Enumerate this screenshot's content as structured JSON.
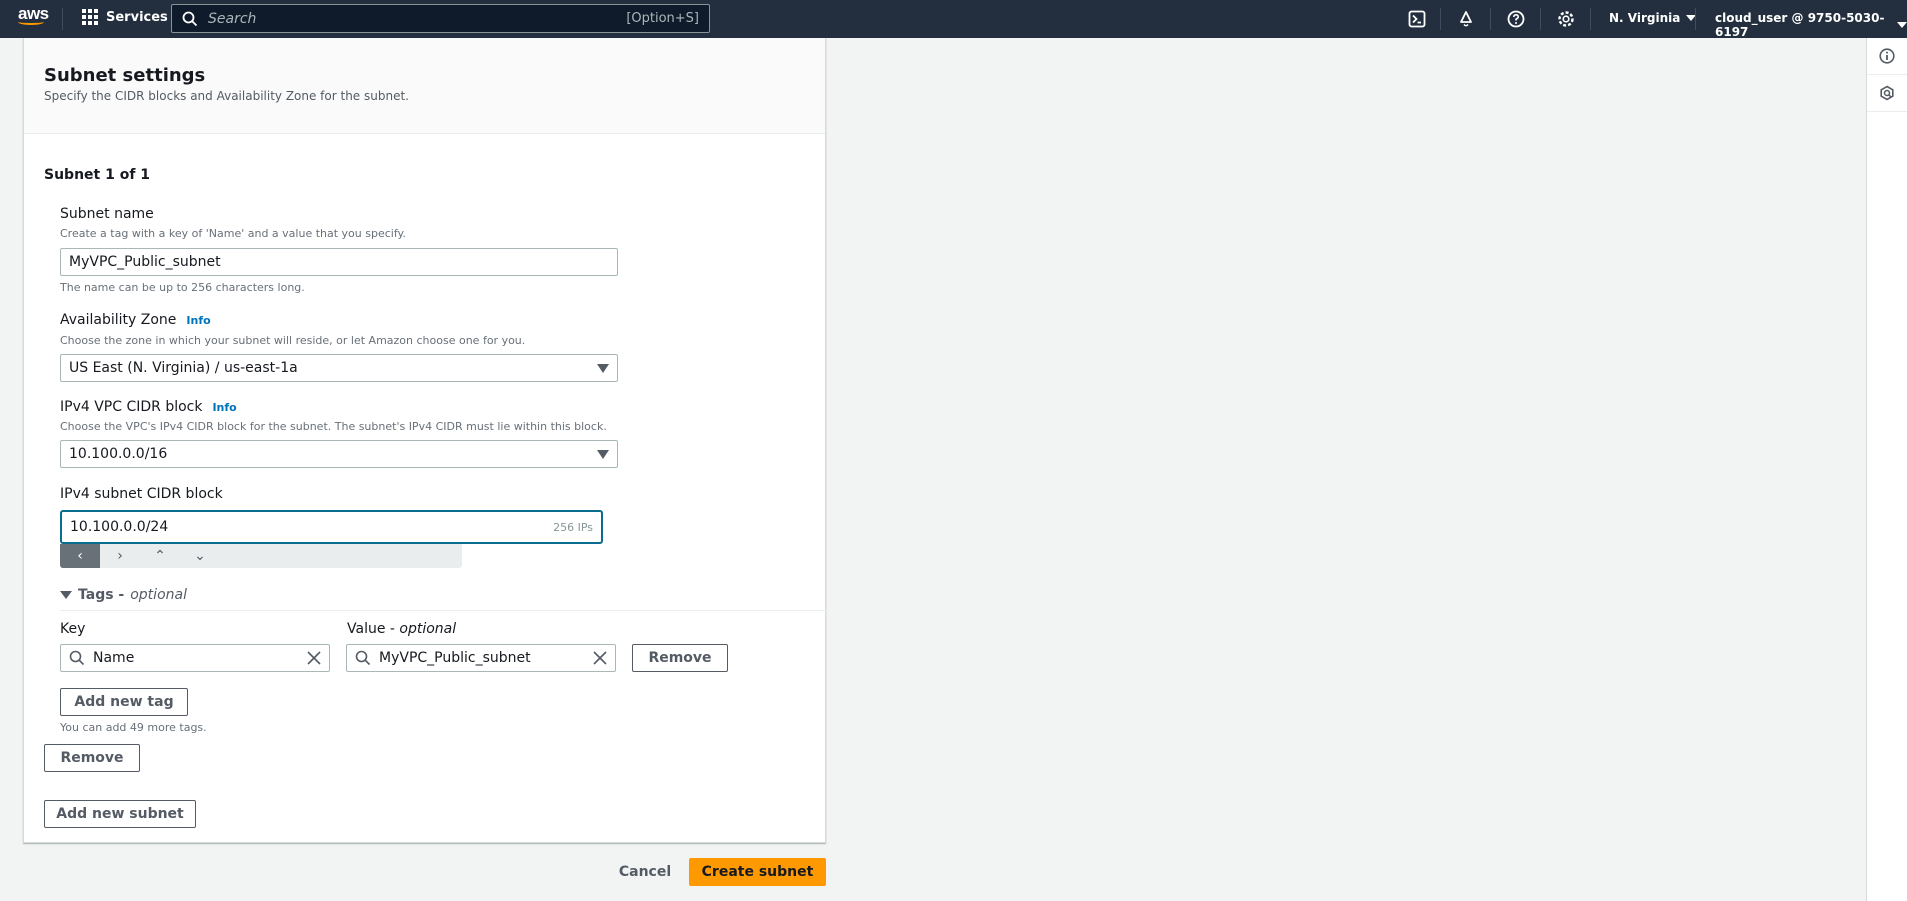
{
  "topnav": {
    "logo": "aws",
    "services_label": "Services",
    "search_placeholder": "Search",
    "search_shortcut": "[Option+S]",
    "icons": [
      "cloudshell-icon",
      "notifications-icon",
      "help-icon",
      "settings-icon"
    ],
    "region": "N. Virginia",
    "account": "cloud_user @ 9750-5030-6197"
  },
  "right_rail": {
    "icons": [
      "info-icon",
      "feedback-icon"
    ]
  },
  "panel": {
    "title": "Subnet settings",
    "description": "Specify the CIDR blocks and Availability Zone for the subnet.",
    "subnet_count": "Subnet 1 of 1",
    "subnet_name": {
      "label": "Subnet name",
      "description": "Create a tag with a key of 'Name' and a value that you specify.",
      "value": "MyVPC_Public_subnet",
      "constraint": "The name can be up to 256 characters long."
    },
    "availability_zone": {
      "label": "Availability Zone",
      "info": "Info",
      "description": "Choose the zone in which your subnet will reside, or let Amazon choose one for you.",
      "value": "US East (N. Virginia) / us-east-1a"
    },
    "vpc_cidr": {
      "label": "IPv4 VPC CIDR block",
      "info": "Info",
      "description": "Choose the VPC's IPv4 CIDR block for the subnet. The subnet's IPv4 CIDR must lie within this block.",
      "value": "10.100.0.0/16"
    },
    "subnet_cidr": {
      "label": "IPv4 subnet CIDR block",
      "value": "10.100.0.0/24",
      "ip_count": "256 IPs",
      "nav_buttons": [
        "‹",
        "›",
        "⌃",
        "⌄"
      ]
    },
    "tags": {
      "heading": "Tags -",
      "heading_optional": "optional",
      "key_label": "Key",
      "value_label": "Value -",
      "value_optional": "optional",
      "key_value": "Name",
      "value_value": "MyVPC_Public_subnet",
      "remove_label": "Remove",
      "add_tag_label": "Add new tag",
      "remaining": "You can add 49 more tags."
    },
    "remove_subnet_label": "Remove",
    "add_subnet_label": "Add new subnet"
  },
  "footer": {
    "cancel_label": "Cancel",
    "create_label": "Create subnet"
  }
}
